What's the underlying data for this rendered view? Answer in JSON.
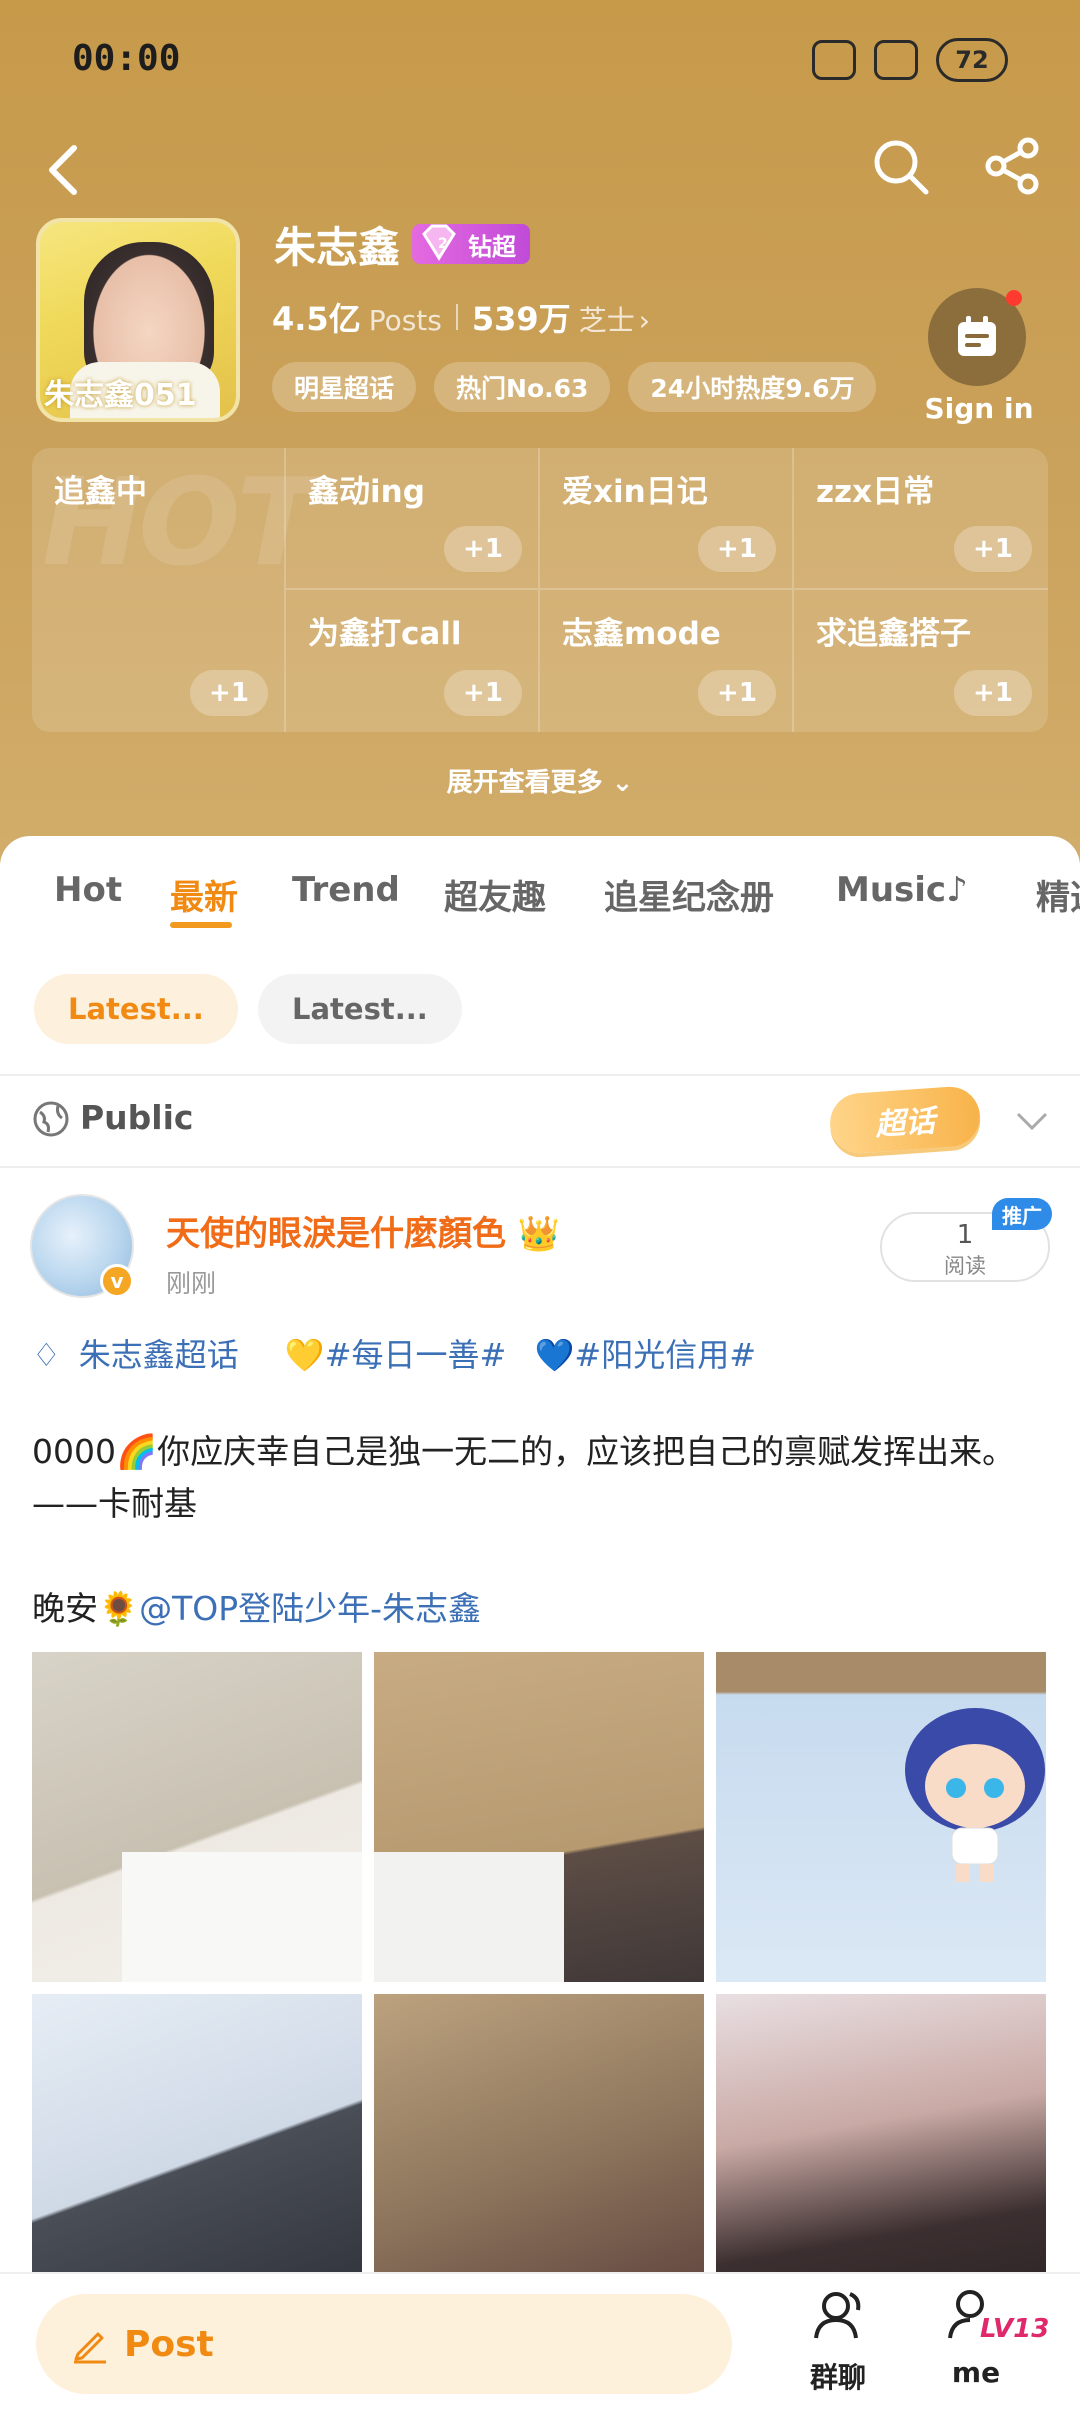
{
  "status_bar": {
    "time": "00:00",
    "battery": "72"
  },
  "header": {
    "name": "朱志鑫",
    "badge_label": "钻超",
    "badge_level": "2",
    "avatar_text": "朱志鑫051",
    "posts_count": "4.5亿",
    "posts_label": "Posts",
    "fans_count": "539万",
    "fans_label": "芝士",
    "tags": [
      "明星超话",
      "热门No.63",
      "24小时热度9.6万"
    ],
    "signin_label": "Sign in",
    "grid": [
      {
        "label": "追鑫中",
        "plus": "+1"
      },
      {
        "label": "鑫动ing",
        "plus": "+1"
      },
      {
        "label": "爱xin日记",
        "plus": "+1"
      },
      {
        "label": "zzx日常",
        "plus": "+1"
      },
      {
        "label": "为鑫打call",
        "plus": "+1"
      },
      {
        "label": "志鑫mode",
        "plus": "+1"
      },
      {
        "label": "求追鑫搭子",
        "plus": "+1"
      }
    ],
    "hot_watermark": "HOT",
    "expand_label": "展开查看更多"
  },
  "tabs": [
    "Hot",
    "最新",
    "Trend",
    "超友趣",
    "追星纪念册",
    "Music",
    "精选"
  ],
  "active_tab": "最新",
  "filters": [
    "Latest...",
    "Latest..."
  ],
  "public_label": "Public",
  "sticker_label": "超话",
  "post": {
    "author": "天使的眼淚是什麼顏色",
    "time": "刚刚",
    "read_count": "1",
    "read_label": "阅读",
    "promo": "推广",
    "hashtags": [
      "朱志鑫超话",
      "💛#每日一善#",
      "💙#阳光信用#"
    ],
    "body": "0000🌈你应庆幸自己是独一无二的，应该把自己的禀赋发挥出来。——卡耐基",
    "night_prefix": "晚安🌻",
    "mention": "@TOP登陆少年-朱志鑫"
  },
  "bottom_bar": {
    "post_label": "Post",
    "group_chat": "群聊",
    "me": "me",
    "level": "LV13"
  },
  "colors": {
    "header_gold": "#c79a4a",
    "accent_orange": "#f08a12",
    "link_blue": "#3b6fb6"
  }
}
